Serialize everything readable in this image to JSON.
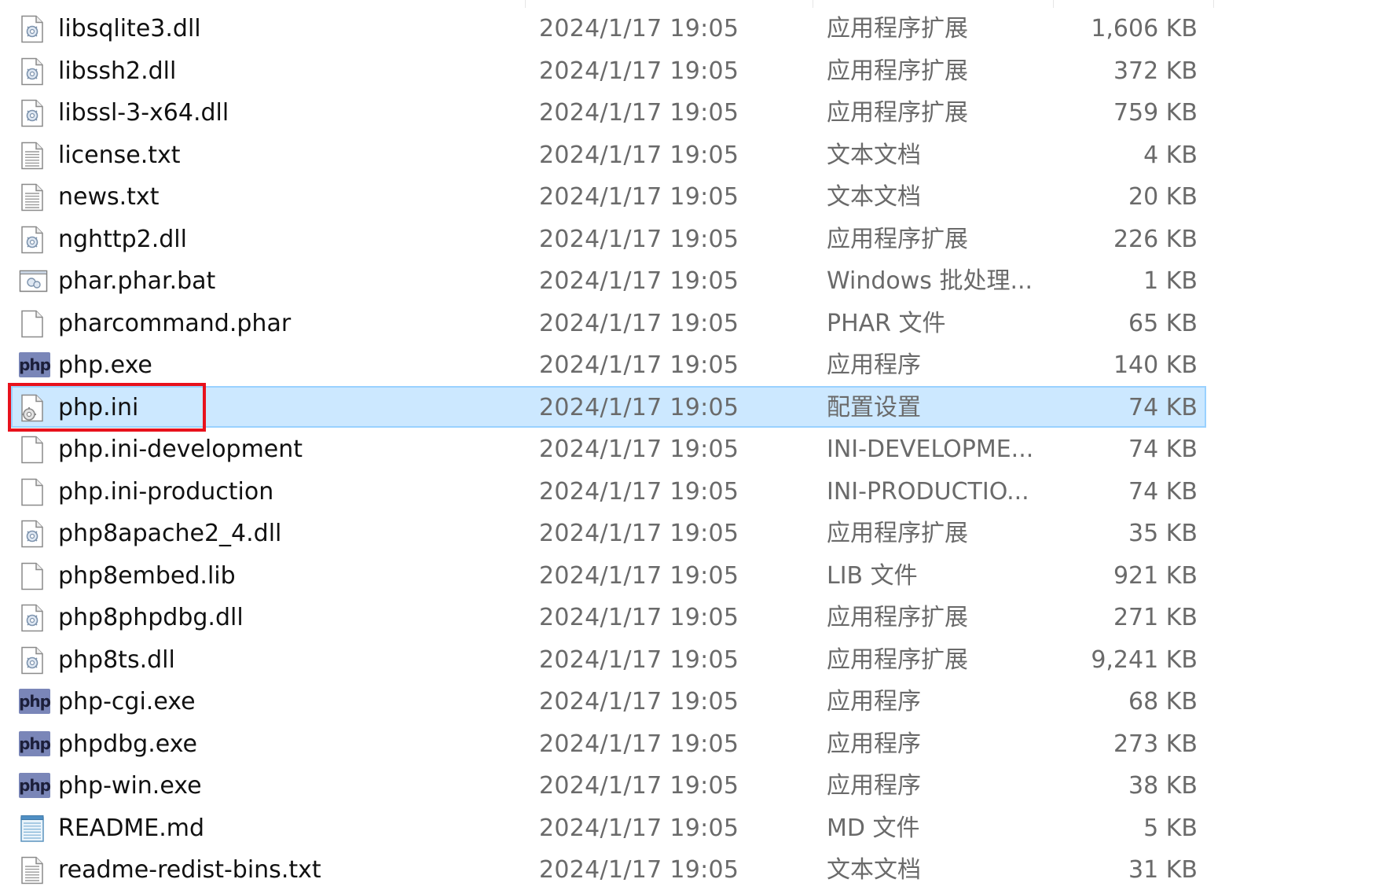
{
  "files": [
    {
      "name": "libsqlite3.dll",
      "date": "2024/1/17 19:05",
      "type": "应用程序扩展",
      "size": "1,606 KB",
      "icon": "dll-icon"
    },
    {
      "name": "libssh2.dll",
      "date": "2024/1/17 19:05",
      "type": "应用程序扩展",
      "size": "372 KB",
      "icon": "dll-icon"
    },
    {
      "name": "libssl-3-x64.dll",
      "date": "2024/1/17 19:05",
      "type": "应用程序扩展",
      "size": "759 KB",
      "icon": "dll-icon"
    },
    {
      "name": "license.txt",
      "date": "2024/1/17 19:05",
      "type": "文本文档",
      "size": "4 KB",
      "icon": "text-file-icon"
    },
    {
      "name": "news.txt",
      "date": "2024/1/17 19:05",
      "type": "文本文档",
      "size": "20 KB",
      "icon": "text-file-icon"
    },
    {
      "name": "nghttp2.dll",
      "date": "2024/1/17 19:05",
      "type": "应用程序扩展",
      "size": "226 KB",
      "icon": "dll-icon"
    },
    {
      "name": "phar.phar.bat",
      "date": "2024/1/17 19:05",
      "type": "Windows 批处理...",
      "size": "1 KB",
      "icon": "batch-file-icon"
    },
    {
      "name": "pharcommand.phar",
      "date": "2024/1/17 19:05",
      "type": "PHAR 文件",
      "size": "65 KB",
      "icon": "blank-file-icon"
    },
    {
      "name": "php.exe",
      "date": "2024/1/17 19:05",
      "type": "应用程序",
      "size": "140 KB",
      "icon": "php-icon"
    },
    {
      "name": "php.ini",
      "date": "2024/1/17 19:05",
      "type": "配置设置",
      "size": "74 KB",
      "icon": "config-file-icon",
      "selected": true
    },
    {
      "name": "php.ini-development",
      "date": "2024/1/17 19:05",
      "type": "INI-DEVELOPME...",
      "size": "74 KB",
      "icon": "blank-file-icon"
    },
    {
      "name": "php.ini-production",
      "date": "2024/1/17 19:05",
      "type": "INI-PRODUCTIO...",
      "size": "74 KB",
      "icon": "blank-file-icon"
    },
    {
      "name": "php8apache2_4.dll",
      "date": "2024/1/17 19:05",
      "type": "应用程序扩展",
      "size": "35 KB",
      "icon": "dll-icon"
    },
    {
      "name": "php8embed.lib",
      "date": "2024/1/17 19:05",
      "type": "LIB 文件",
      "size": "921 KB",
      "icon": "blank-file-icon"
    },
    {
      "name": "php8phpdbg.dll",
      "date": "2024/1/17 19:05",
      "type": "应用程序扩展",
      "size": "271 KB",
      "icon": "dll-icon"
    },
    {
      "name": "php8ts.dll",
      "date": "2024/1/17 19:05",
      "type": "应用程序扩展",
      "size": "9,241 KB",
      "icon": "dll-icon"
    },
    {
      "name": "php-cgi.exe",
      "date": "2024/1/17 19:05",
      "type": "应用程序",
      "size": "68 KB",
      "icon": "php-icon"
    },
    {
      "name": "phpdbg.exe",
      "date": "2024/1/17 19:05",
      "type": "应用程序",
      "size": "273 KB",
      "icon": "php-icon"
    },
    {
      "name": "php-win.exe",
      "date": "2024/1/17 19:05",
      "type": "应用程序",
      "size": "38 KB",
      "icon": "php-icon"
    },
    {
      "name": "README.md",
      "date": "2024/1/17 19:05",
      "type": "MD 文件",
      "size": "5 KB",
      "icon": "notepad-file-icon"
    },
    {
      "name": "readme-redist-bins.txt",
      "date": "2024/1/17 19:05",
      "type": "文本文档",
      "size": "31 KB",
      "icon": "text-file-icon"
    }
  ],
  "php_badge_text": "php",
  "colors": {
    "selection_bg": "#cce8ff",
    "selection_border": "#99d1ff",
    "highlight_box": "#e8111c"
  }
}
